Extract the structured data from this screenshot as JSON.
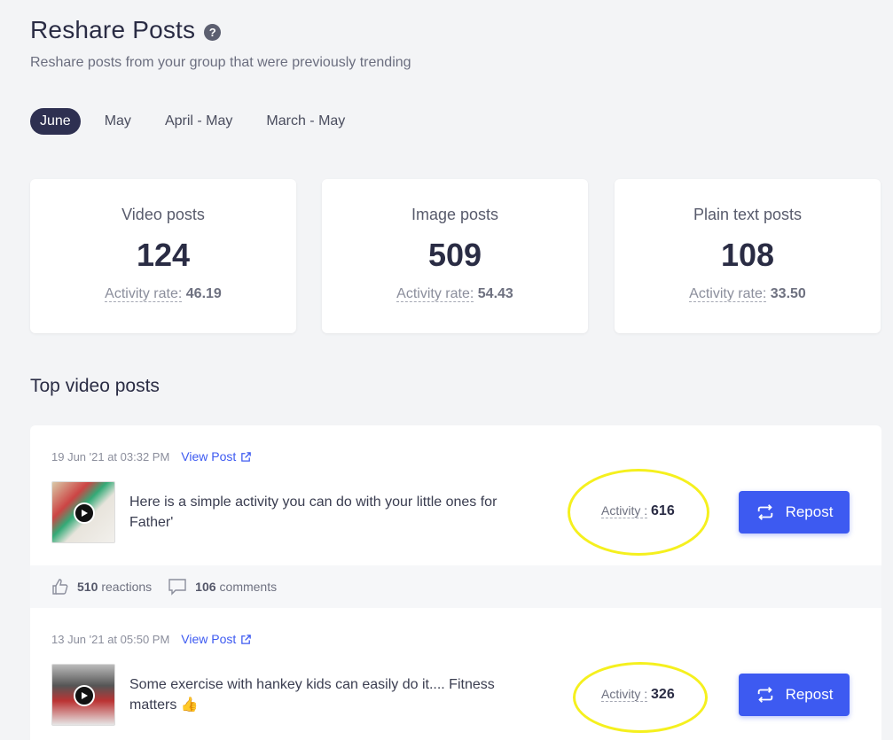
{
  "header": {
    "title": "Reshare Posts",
    "help_icon": "question-circle-icon",
    "subtitle": "Reshare posts from your group that were previously trending"
  },
  "period_tabs": [
    {
      "label": "June",
      "active": true
    },
    {
      "label": "May",
      "active": false
    },
    {
      "label": "April - May",
      "active": false
    },
    {
      "label": "March - May",
      "active": false
    }
  ],
  "stats": [
    {
      "label": "Video posts",
      "value": "124",
      "rate_label": "Activity rate:",
      "rate_value": "46.19"
    },
    {
      "label": "Image posts",
      "value": "509",
      "rate_label": "Activity rate:",
      "rate_value": "54.43"
    },
    {
      "label": "Plain text posts",
      "value": "108",
      "rate_label": "Activity rate:",
      "rate_value": "33.50"
    }
  ],
  "section_title": "Top video posts",
  "posts": [
    {
      "date": "19 Jun '21 at 03:32 PM",
      "view_label": "View Post",
      "text": "Here is a simple activity you can do with your little ones for Father'",
      "activity_label": "Activity :",
      "activity_value": "616",
      "repost_label": "Repost",
      "reactions_count": "510",
      "reactions_label": "reactions",
      "comments_count": "106",
      "comments_label": "comments"
    },
    {
      "date": "13 Jun '21 at 05:50 PM",
      "view_label": "View Post",
      "text": "Some exercise with hankey kids can easily do it.... Fitness matters 👍",
      "activity_label": "Activity :",
      "activity_value": "326",
      "repost_label": "Repost"
    }
  ],
  "colors": {
    "accent": "#3d5af1",
    "active_tab": "#2e3051",
    "highlight": "#f5f01e"
  }
}
